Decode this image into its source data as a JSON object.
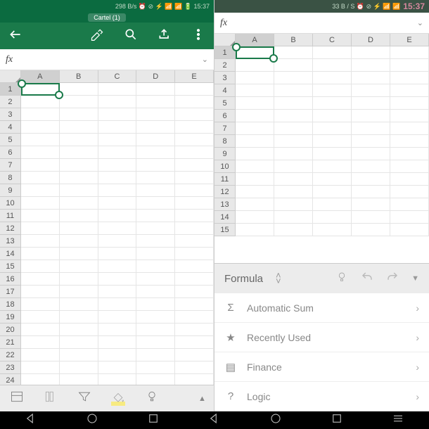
{
  "left": {
    "status": "298 B/s ⏰ ⊘ ⚡ 📶 📶 🔋 15:37",
    "title": "Cartel (1)",
    "fx": "fx",
    "cols": [
      "A",
      "B",
      "C",
      "D",
      "E"
    ],
    "rows": [
      "1",
      "2",
      "3",
      "4",
      "5",
      "6",
      "7",
      "8",
      "9",
      "10",
      "11",
      "12",
      "13",
      "14",
      "15",
      "16",
      "17",
      "18",
      "19",
      "20",
      "21",
      "22",
      "23",
      "24"
    ]
  },
  "right": {
    "status_left": "33 B / S ⏰ ⊘ ⚡ 📶 📶",
    "status_time": "15:37",
    "fx": "fx",
    "cols": [
      "A",
      "B",
      "C",
      "D",
      "E"
    ],
    "rows": [
      "1",
      "2",
      "3",
      "4",
      "5",
      "6",
      "7",
      "8",
      "9",
      "10",
      "11",
      "12",
      "13",
      "14",
      "15"
    ],
    "panel": {
      "title": "Formula",
      "items": [
        {
          "icon": "Σ",
          "label": "Automatic Sum"
        },
        {
          "icon": "★",
          "label": "Recently Used"
        },
        {
          "icon": "▤",
          "label": "Finance"
        },
        {
          "icon": "?",
          "label": "Logic"
        }
      ]
    }
  }
}
